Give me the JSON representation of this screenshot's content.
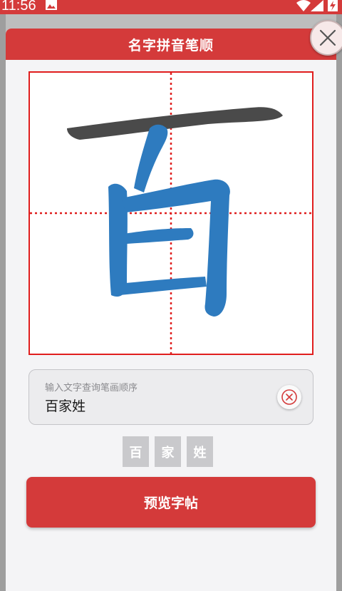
{
  "status_bar": {
    "time": "11:56",
    "icons": [
      "image-icon",
      "wifi-icon",
      "signal-icon",
      "battery-charging-icon"
    ]
  },
  "dialog": {
    "title": "名字拼音笔顺",
    "close_icon": "close-icon"
  },
  "stroke_board": {
    "character": "百",
    "grid": "tian-zi-ge dotted guide lines",
    "colors": {
      "completed_stroke": "#4a4a4a",
      "pending_stroke": "#2e7bbf",
      "border": "#e01e1e",
      "guide": "#e01e1e"
    }
  },
  "query": {
    "label": "输入文字查询笔画顺序",
    "value": "百家姓",
    "clear_icon": "clear-circle-icon"
  },
  "chars": [
    {
      "label": "百"
    },
    {
      "label": "家"
    },
    {
      "label": "姓"
    }
  ],
  "preview_button": {
    "label": "预览字帖"
  },
  "colors": {
    "accent": "#d43a3a",
    "chip": "#c9c9cc"
  }
}
